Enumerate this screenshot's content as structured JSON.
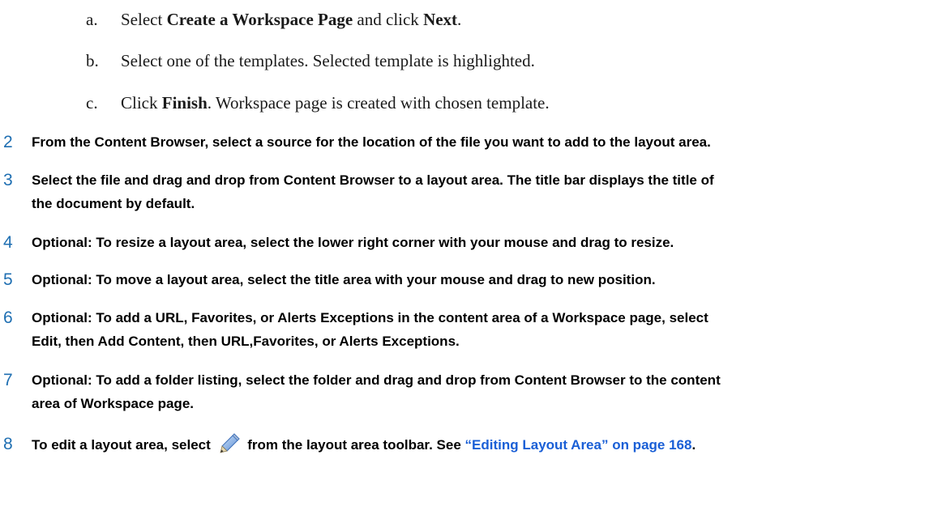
{
  "substeps": [
    {
      "letter": "a.",
      "t1": "Select ",
      "b1": "Create a Workspace Page",
      "t2": " and click ",
      "b2": "Next",
      "t3": "."
    },
    {
      "letter": "b.",
      "t1": "Select one of the templates. Selected template is highlighted."
    },
    {
      "letter": "c.",
      "t1": "Click ",
      "b1": "Finish",
      "t2": ". Workspace page is created with chosen template."
    }
  ],
  "steps": {
    "s2": {
      "num": "2",
      "text": "From the Content Browser, select a source for the location of the file you want to add to the layout area."
    },
    "s3": {
      "num": "3",
      "line1": "Select the file and drag and drop from Content Browser to a layout area. The title bar displays the title of",
      "line2": "the document by default."
    },
    "s4": {
      "num": "4",
      "optional": "Optional:",
      "text": " To resize a layout area, select the lower right corner with your mouse and drag to resize."
    },
    "s5": {
      "num": "5",
      "optional": "Optional:",
      "text": " To move a layout area, select the title area with your mouse and drag to new position."
    },
    "s6": {
      "num": "6",
      "optional": "Optional:",
      "line1": " To add a URL, Favorites, or Alerts Exceptions in the content area of a Workspace page, select",
      "kw1": "Edit",
      "t1": ", then ",
      "kw2": "Add Content",
      "t2": ", then ",
      "kw3": "URL",
      "t3": ",",
      "kw4": "Favorites",
      "t4": ", or ",
      "kw5": "Alerts Exceptions",
      "t5": "."
    },
    "s7": {
      "num": "7",
      "optional": "Optional:",
      "line1": " To add a folder listing, select the folder and drag and drop from Content Browser to the content",
      "line2": "area of Workspace page."
    },
    "s8": {
      "num": "8",
      "t1": "To edit a layout area, select ",
      "t2": " from the layout area toolbar. See ",
      "link": "“Editing Layout Area” on page 168",
      "t3": ".",
      "icon": "pencil-edit-icon"
    }
  },
  "colors": {
    "step_number": "#1f6fb2",
    "link": "#1a5fd6"
  }
}
